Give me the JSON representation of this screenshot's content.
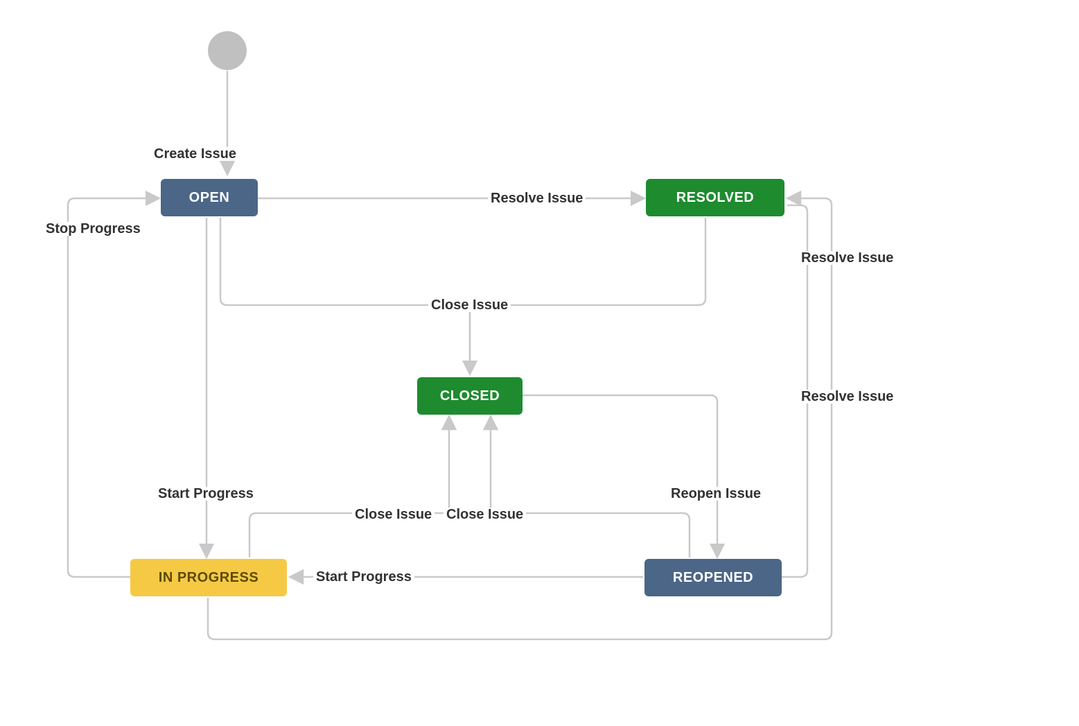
{
  "diagram": {
    "type": "state-workflow",
    "nodes": {
      "open": {
        "label": "OPEN",
        "color": "blue"
      },
      "resolved": {
        "label": "RESOLVED",
        "color": "green"
      },
      "closed": {
        "label": "CLOSED",
        "color": "green"
      },
      "in_progress": {
        "label": "IN PROGRESS",
        "color": "yellow"
      },
      "reopened": {
        "label": "REOPENED",
        "color": "blue"
      }
    },
    "transitions": {
      "create_issue": {
        "label": "Create Issue",
        "from": "start",
        "to": "open"
      },
      "open_resolve": {
        "label": "Resolve Issue",
        "from": "open",
        "to": "resolved"
      },
      "open_close": {
        "label": "Close Issue",
        "from": "open",
        "to": "closed"
      },
      "resolved_close": {
        "label": "Close Issue",
        "from": "resolved",
        "to": "closed"
      },
      "open_start_progress": {
        "label": "Start Progress",
        "from": "open",
        "to": "in_progress"
      },
      "inprogress_stop": {
        "label": "Stop Progress",
        "from": "in_progress",
        "to": "open"
      },
      "inprogress_resolve": {
        "label": "Resolve Issue",
        "from": "in_progress",
        "to": "resolved"
      },
      "inprogress_close": {
        "label": "Close Issue",
        "from": "in_progress",
        "to": "closed"
      },
      "closed_reopen": {
        "label": "Reopen Issue",
        "from": "closed",
        "to": "reopened"
      },
      "reopened_start_progress": {
        "label": "Start Progress",
        "from": "reopened",
        "to": "in_progress"
      },
      "reopened_resolve": {
        "label": "Resolve Issue",
        "from": "reopened",
        "to": "resolved"
      },
      "reopened_close": {
        "label": "Close Issue",
        "from": "reopened",
        "to": "closed"
      }
    },
    "colors": {
      "blue": "#4b6687",
      "green": "#1e8b2f",
      "yellow": "#f6c945",
      "edge": "#c9c9c9",
      "text": "#303234"
    }
  }
}
